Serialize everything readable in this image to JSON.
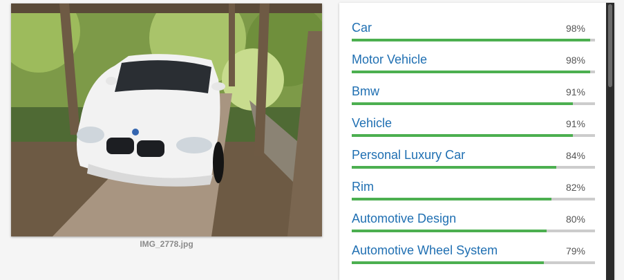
{
  "image": {
    "caption": "IMG_2778.jpg",
    "icon": "car-photo"
  },
  "colors": {
    "label_text": "#1f6fb2",
    "bar_fill": "#4caf50",
    "bar_track": "#cccccc"
  },
  "labels": [
    {
      "name": "Car",
      "score": 98,
      "score_text": "98%"
    },
    {
      "name": "Motor Vehicle",
      "score": 98,
      "score_text": "98%"
    },
    {
      "name": "Bmw",
      "score": 91,
      "score_text": "91%"
    },
    {
      "name": "Vehicle",
      "score": 91,
      "score_text": "91%"
    },
    {
      "name": "Personal Luxury Car",
      "score": 84,
      "score_text": "84%"
    },
    {
      "name": "Rim",
      "score": 82,
      "score_text": "82%"
    },
    {
      "name": "Automotive Design",
      "score": 80,
      "score_text": "80%"
    },
    {
      "name": "Automotive Wheel System",
      "score": 79,
      "score_text": "79%"
    }
  ]
}
